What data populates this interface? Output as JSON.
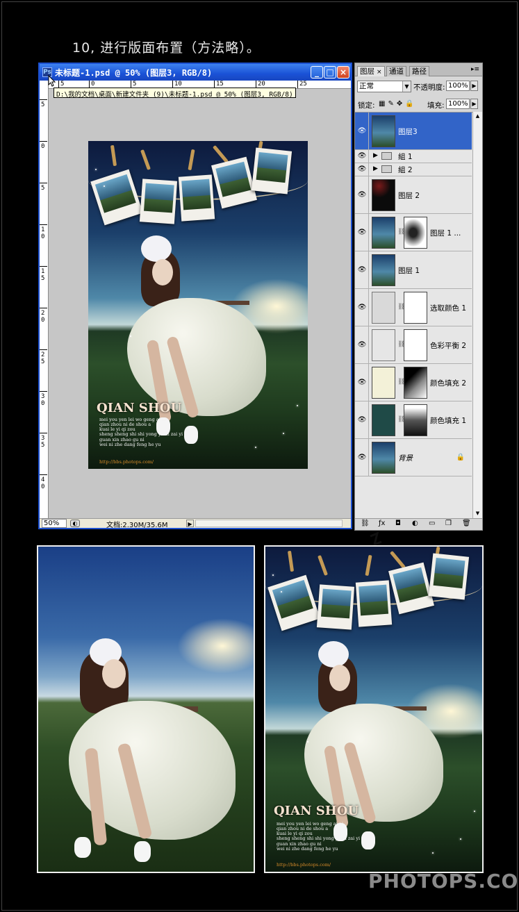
{
  "step_title": "10, 进行版面布置（方法略）。",
  "window": {
    "title": "未标题-1.psd @ 50% (图层3, RGB/8)",
    "tooltip_path": "D:\\我的文档\\桌面\\新建文件夹 (9)\\未标题-1.psd @ 50% (图层3, RGB/8)",
    "ruler_h_ticks": [
      "5",
      "0",
      "5",
      "10",
      "15",
      "20",
      "25"
    ],
    "ruler_v_ticks": [
      "5",
      "0",
      "5",
      "1 0",
      "1 5",
      "2 0",
      "2 5",
      "3 0",
      "3 5",
      "4 0"
    ],
    "zoom": "50%",
    "doc_info": "文档:2.30M/35.6M"
  },
  "poster": {
    "brand": "QIAN SHOU",
    "lyrics": "mei you yen lei wo geng ai ni\nqian zhou ni de shou a\nkuai le yi qi zou\nsheng sheng shi shi yong yuan zai yi qi\nguan xin zhao gu ni\nwei ni zhe dang feng he yu",
    "url": "http://bbs.photops.com/"
  },
  "layers_panel": {
    "tabs": [
      "图层",
      "通道",
      "路径"
    ],
    "tab_close": "×",
    "blend_mode": "正常",
    "opacity_label": "不透明度:",
    "opacity": "100%",
    "lock_label": "锁定:",
    "fill_label": "填充:",
    "fill": "100%",
    "layers": [
      {
        "name": "图层3",
        "type": "image",
        "selected": true
      },
      {
        "name": "組 1",
        "type": "group"
      },
      {
        "name": "組 2",
        "type": "group"
      },
      {
        "name": "图层 2",
        "type": "image"
      },
      {
        "name": "图层 1 ...",
        "type": "image-mask"
      },
      {
        "name": "图层 1",
        "type": "image"
      },
      {
        "name": "选取颜色 1",
        "type": "adjustment"
      },
      {
        "name": "色彩平衡 2",
        "type": "adjustment"
      },
      {
        "name": "颜色填充 2",
        "type": "fill",
        "color": "#f3f1d8"
      },
      {
        "name": "颜色填充 1",
        "type": "fill",
        "color": "#1f4a47"
      },
      {
        "name": "背景",
        "type": "background"
      }
    ]
  },
  "watermark": "PHOTOPS.COM",
  "colors": {
    "titlebar": "#1a52d6",
    "selected_layer": "#3264c8",
    "url_text": "#d98c2a"
  }
}
